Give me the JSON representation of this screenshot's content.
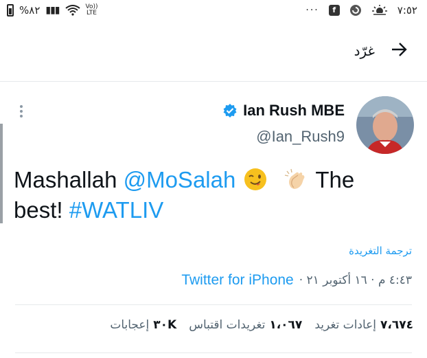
{
  "status_bar": {
    "battery": "%٨٢",
    "network_top": "Vo))",
    "network_bottom": "LTE",
    "time": "٧:٥٢",
    "overflow": "···"
  },
  "header": {
    "title": "غرّد"
  },
  "tweet": {
    "display_name": "Ian Rush MBE",
    "handle": "@Ian_Rush9",
    "text_part1": "Mashallah ",
    "mention": "@MoSalah",
    "text_part2": "The best! ",
    "hashtag": "#WATLIV",
    "translate_label": "ترجمة التغريدة",
    "timestamp": "٤:٤٣ م · ١٦ أكتوبر ٢١ ·",
    "source": "Twitter for iPhone"
  },
  "stats": {
    "retweets_count": "٧،٦٧٤",
    "retweets_label": "إعادات تغريد",
    "quotes_count": "١،٠٦٧",
    "quotes_label": "تغريدات اقتباس",
    "likes_count": "٣٠K",
    "likes_label": "إعجابات"
  },
  "colors": {
    "accent": "#1d9bf0",
    "text_primary": "#0f1419",
    "text_secondary": "#536471",
    "divider": "#e6e9eb"
  }
}
